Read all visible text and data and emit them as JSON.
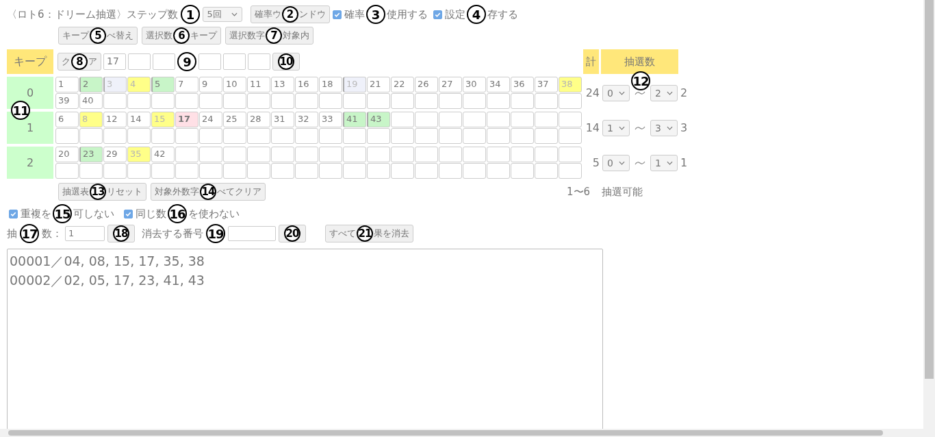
{
  "header": {
    "title": "〈ロト6：ドリーム抽選〉ステップ数",
    "title_marker": "1",
    "step_select": {
      "value": "5回"
    },
    "prob_button": {
      "parts": [
        "確率ウ",
        "ンドウ"
      ],
      "marker": "2"
    },
    "checks": [
      {
        "parts": [
          "確率",
          "使用する"
        ],
        "checked": true,
        "marker": "3"
      },
      {
        "parts": [
          "設定",
          "存する"
        ],
        "checked": true,
        "marker": "4"
      }
    ]
  },
  "toolbar": [
    {
      "parts": [
        "キープ",
        "べ替え"
      ],
      "marker": "5"
    },
    {
      "parts": [
        "選択数",
        "キープ"
      ],
      "marker": "6"
    },
    {
      "parts": [
        "選択数字",
        "対象内"
      ],
      "marker": "7"
    }
  ],
  "keep_row": {
    "label": "キープ",
    "clear_button": {
      "parts": [
        "ク",
        "ア"
      ],
      "marker": "8"
    },
    "values": [
      "17"
    ],
    "fields_marker": "9",
    "add_button": {
      "marker": "10"
    }
  },
  "summary_headers": {
    "total": "計",
    "draw_count": "抽選数",
    "marker": "12"
  },
  "groups": [
    {
      "label": "0",
      "marker": "11",
      "total": "24",
      "min": "0",
      "max": "2",
      "max_note": "2",
      "cells": [
        {
          "n": "1",
          "kind": "plain"
        },
        {
          "n": "2",
          "kind": "selected"
        },
        {
          "n": "3",
          "kind": "excluded"
        },
        {
          "n": "4",
          "kind": "drawn"
        },
        {
          "n": "5",
          "kind": "selected"
        },
        {
          "n": "7",
          "kind": "plain"
        },
        {
          "n": "9",
          "kind": "plain"
        },
        {
          "n": "10",
          "kind": "plain"
        },
        {
          "n": "11",
          "kind": "plain"
        },
        {
          "n": "13",
          "kind": "plain"
        },
        {
          "n": "16",
          "kind": "plain"
        },
        {
          "n": "18",
          "kind": "plain"
        },
        {
          "n": "19",
          "kind": "excluded"
        },
        {
          "n": "21",
          "kind": "plain"
        },
        {
          "n": "22",
          "kind": "plain"
        },
        {
          "n": "26",
          "kind": "plain"
        },
        {
          "n": "27",
          "kind": "plain"
        },
        {
          "n": "30",
          "kind": "plain"
        },
        {
          "n": "34",
          "kind": "plain"
        },
        {
          "n": "36",
          "kind": "plain"
        },
        {
          "n": "37",
          "kind": "plain"
        },
        {
          "n": "38",
          "kind": "drawn"
        },
        {
          "n": "39",
          "kind": "plain"
        },
        {
          "n": "40",
          "kind": "plain"
        }
      ]
    },
    {
      "label": "1",
      "total": "14",
      "min": "1",
      "max": "3",
      "max_note": "3",
      "cells": [
        {
          "n": "6",
          "kind": "plain"
        },
        {
          "n": "8",
          "kind": "drawn"
        },
        {
          "n": "12",
          "kind": "plain"
        },
        {
          "n": "14",
          "kind": "plain"
        },
        {
          "n": "15",
          "kind": "drawn"
        },
        {
          "n": "17",
          "kind": "kept"
        },
        {
          "n": "24",
          "kind": "plain"
        },
        {
          "n": "25",
          "kind": "plain"
        },
        {
          "n": "28",
          "kind": "plain"
        },
        {
          "n": "31",
          "kind": "plain"
        },
        {
          "n": "32",
          "kind": "plain"
        },
        {
          "n": "33",
          "kind": "plain"
        },
        {
          "n": "41",
          "kind": "selected"
        },
        {
          "n": "43",
          "kind": "selected"
        }
      ]
    },
    {
      "label": "2",
      "total": "5",
      "min": "0",
      "max": "1",
      "max_note": "1",
      "cells": [
        {
          "n": "20",
          "kind": "plain"
        },
        {
          "n": "23",
          "kind": "selected"
        },
        {
          "n": "29",
          "kind": "plain"
        },
        {
          "n": "35",
          "kind": "drawn"
        },
        {
          "n": "42",
          "kind": "plain"
        }
      ]
    }
  ],
  "range_note": {
    "range": "1〜6",
    "text": "抽選可能"
  },
  "actions": [
    {
      "parts": [
        "抽選表",
        "リセット"
      ],
      "marker": "13"
    },
    {
      "parts": [
        "対象外数字",
        "べてクリア"
      ],
      "marker": "14"
    }
  ],
  "options": [
    {
      "parts": [
        "重複を",
        "可しない"
      ],
      "checked": true,
      "marker": "15"
    },
    {
      "parts": [
        "同じ数",
        "を使わない"
      ],
      "checked": true,
      "marker": "16"
    }
  ],
  "draw_row": {
    "count_parts": [
      "抽",
      "数："
    ],
    "count_marker": "17",
    "count_value": "1",
    "draw_button": {
      "marker": "18"
    },
    "delete_label": "消去する番号",
    "delete_marker": "19",
    "delete_button": {
      "marker": "20"
    },
    "clear_all_button": {
      "parts": [
        "すべて",
        "果を消去"
      ],
      "marker": "21"
    }
  },
  "results": [
    "00001／04, 08, 15, 17, 35, 38",
    "00002／02, 05, 17, 23, 41, 43"
  ]
}
